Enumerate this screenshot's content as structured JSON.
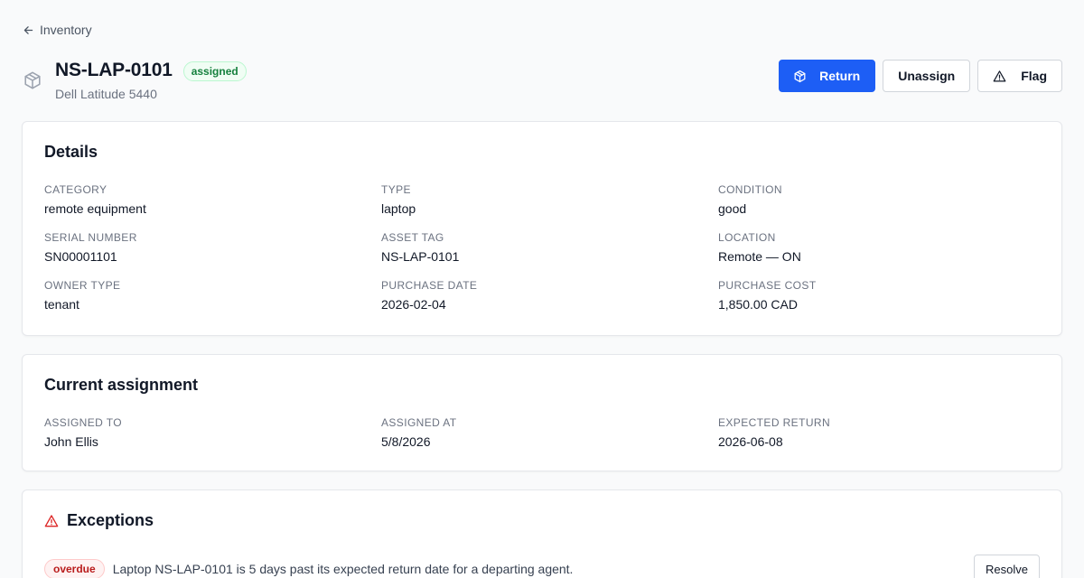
{
  "nav": {
    "back_label": "Inventory"
  },
  "asset": {
    "title": "NS-LAP-0101",
    "status_badge": "assigned",
    "subtitle": "Dell Latitude 5440"
  },
  "actions": {
    "return_label": "Return",
    "unassign_label": "Unassign",
    "flag_label": "Flag"
  },
  "details": {
    "title": "Details",
    "fields": [
      {
        "label": "CATEGORY",
        "value": "remote equipment"
      },
      {
        "label": "TYPE",
        "value": "laptop"
      },
      {
        "label": "CONDITION",
        "value": "good"
      },
      {
        "label": "SERIAL NUMBER",
        "value": "SN00001101"
      },
      {
        "label": "ASSET TAG",
        "value": "NS-LAP-0101"
      },
      {
        "label": "LOCATION",
        "value": "Remote — ON"
      },
      {
        "label": "OWNER TYPE",
        "value": "tenant"
      },
      {
        "label": "PURCHASE DATE",
        "value": "2026-02-04"
      },
      {
        "label": "PURCHASE COST",
        "value": "1,850.00 CAD"
      }
    ]
  },
  "assignment": {
    "title": "Current assignment",
    "fields": [
      {
        "label": "ASSIGNED TO",
        "value": "John Ellis"
      },
      {
        "label": "ASSIGNED AT",
        "value": "5/8/2026"
      },
      {
        "label": "EXPECTED RETURN",
        "value": "2026-06-08"
      }
    ]
  },
  "exceptions": {
    "title": "Exceptions",
    "items": [
      {
        "badge": "overdue",
        "message": "Laptop NS-LAP-0101 is 5 days past its expected return date for a departing agent.",
        "action_label": "Resolve"
      }
    ]
  },
  "colors": {
    "primary": "#1d5ef5",
    "success": "#15803d",
    "danger": "#dc2626"
  }
}
